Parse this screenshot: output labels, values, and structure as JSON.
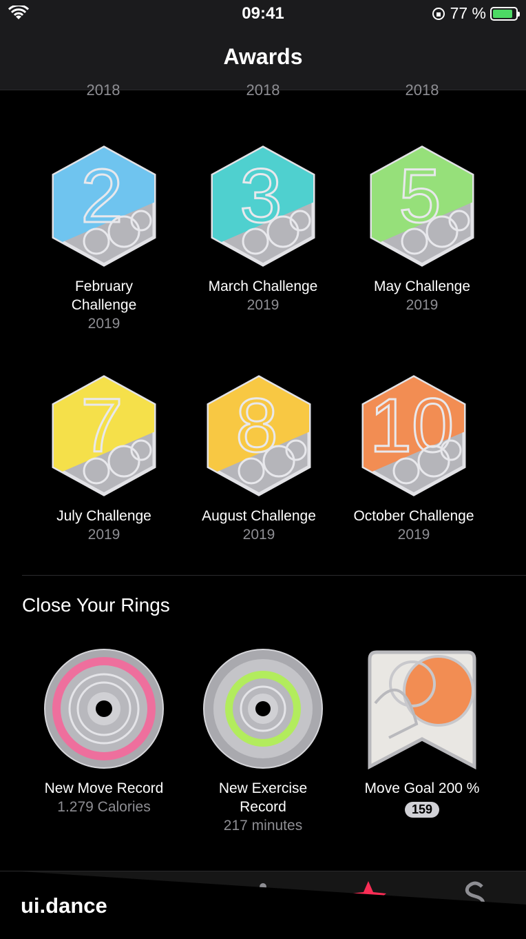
{
  "status_bar": {
    "time": "09:41",
    "battery_percent": "77 %"
  },
  "nav": {
    "title": "Awards"
  },
  "previous_row_years": [
    "2018",
    "2018",
    "2018"
  ],
  "challenges": [
    {
      "numeral": "2",
      "title": "February Challenge",
      "year": "2019",
      "color": "#6fc4ef"
    },
    {
      "numeral": "3",
      "title": "March Challenge",
      "year": "2019",
      "color": "#4fd0cf"
    },
    {
      "numeral": "5",
      "title": "May Challenge",
      "year": "2019",
      "color": "#96e07a"
    },
    {
      "numeral": "7",
      "title": "July Challenge",
      "year": "2019",
      "color": "#f5e04a"
    },
    {
      "numeral": "8",
      "title": "August Challenge",
      "year": "2019",
      "color": "#f8c843"
    },
    {
      "numeral": "10",
      "title": "October Challenge",
      "year": "2019",
      "color": "#f28d53"
    }
  ],
  "rings_section": {
    "title": "Close Your Rings",
    "awards": [
      {
        "title": "New Move Record",
        "sub": "1.279 Calories",
        "color": "#ee6f9d"
      },
      {
        "title": "New Exercise Record",
        "sub": "217 minutes",
        "color": "#b2ec5d"
      },
      {
        "title": "Move Goal 200 %",
        "count": "159",
        "color": "#f28d53"
      }
    ]
  },
  "tab_bar": {
    "items": [
      {
        "icon": "activity-rings-icon"
      },
      {
        "icon": "workouts-icon"
      },
      {
        "icon": "running-figure-icon"
      },
      {
        "icon": "awards-star-icon",
        "active": true
      },
      {
        "icon": "sharing-icon"
      }
    ]
  },
  "watermark": "ui.dance"
}
